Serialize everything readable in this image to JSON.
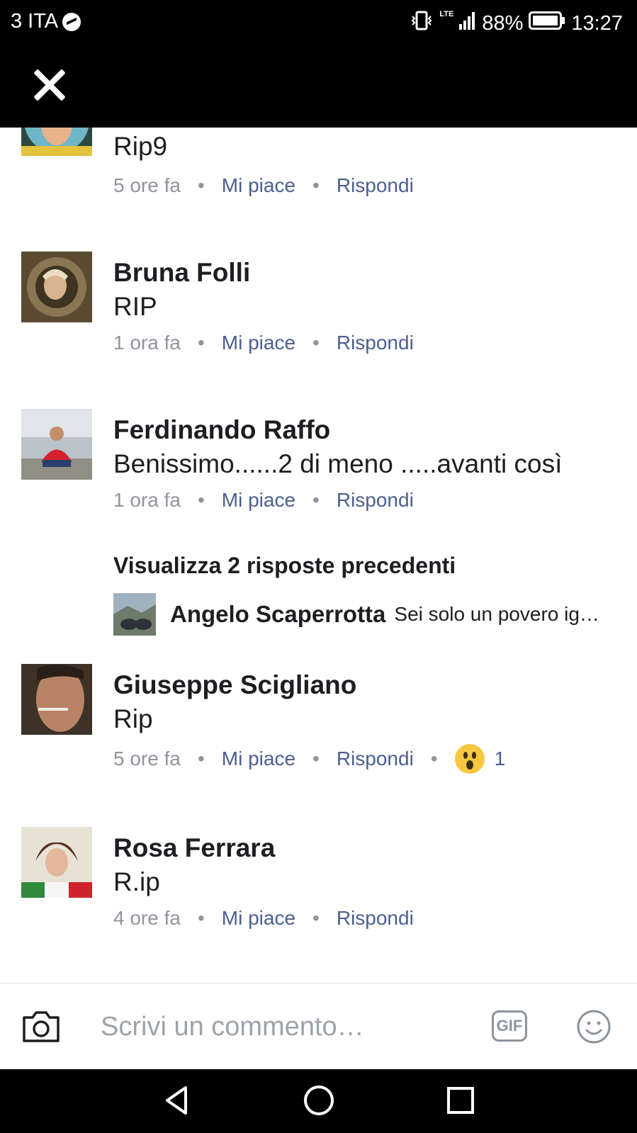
{
  "status_bar": {
    "carrier": "3 ITA",
    "network": "LTE",
    "battery": "88%",
    "time": "13:27"
  },
  "comments": [
    {
      "name": "",
      "text": "Rip9",
      "time": "5 ore fa",
      "like": "Mi piace",
      "reply": "Rispondi"
    },
    {
      "name": "Bruna Folli",
      "text": "RIP",
      "time": "1 ora fa",
      "like": "Mi piace",
      "reply": "Rispondi"
    },
    {
      "name": "Ferdinando Raffo",
      "text": "Benissimo......2 di meno .....avanti così",
      "time": "1 ora fa",
      "like": "Mi piace",
      "reply": "Rispondi"
    },
    {
      "name": "Giuseppe Scigliano",
      "text": "Rip",
      "time": "5 ore fa",
      "like": "Mi piace",
      "reply": "Rispondi",
      "reaction_count": "1"
    },
    {
      "name": "Rosa Ferrara",
      "text": "R.ip",
      "time": "4 ore fa",
      "like": "Mi piace",
      "reply": "Rispondi"
    }
  ],
  "replies": {
    "view_previous": "Visualizza 2 risposte precedenti",
    "preview_name": "Angelo Scaperrotta",
    "preview_text": "Sei solo un povero ig…"
  },
  "composer": {
    "placeholder": "Scrivi un commento…",
    "gif_label": "GIF"
  },
  "colors": {
    "link": "#4b5f8f",
    "meta": "#90949c",
    "text": "#1c1e21"
  }
}
